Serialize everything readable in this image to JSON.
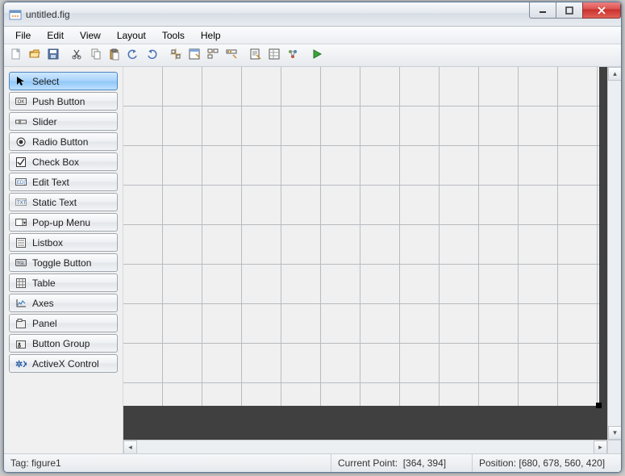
{
  "window": {
    "title": "untitled.fig"
  },
  "menu": {
    "file": "File",
    "edit": "Edit",
    "view": "View",
    "layout": "Layout",
    "tools": "Tools",
    "help": "Help"
  },
  "palette": {
    "select": "Select",
    "push_button": "Push Button",
    "slider": "Slider",
    "radio_button": "Radio Button",
    "check_box": "Check Box",
    "edit_text": "Edit Text",
    "static_text": "Static Text",
    "popup_menu": "Pop-up Menu",
    "listbox": "Listbox",
    "toggle_button": "Toggle Button",
    "table": "Table",
    "axes": "Axes",
    "panel": "Panel",
    "button_group": "Button Group",
    "activex": "ActiveX Control"
  },
  "status": {
    "tag_label": "Tag:",
    "tag_value": "figure1",
    "current_point_label": "Current Point:",
    "current_point_value": "[364, 394]",
    "position_label": "Position:",
    "position_value": "[680, 678, 560, 420]"
  }
}
